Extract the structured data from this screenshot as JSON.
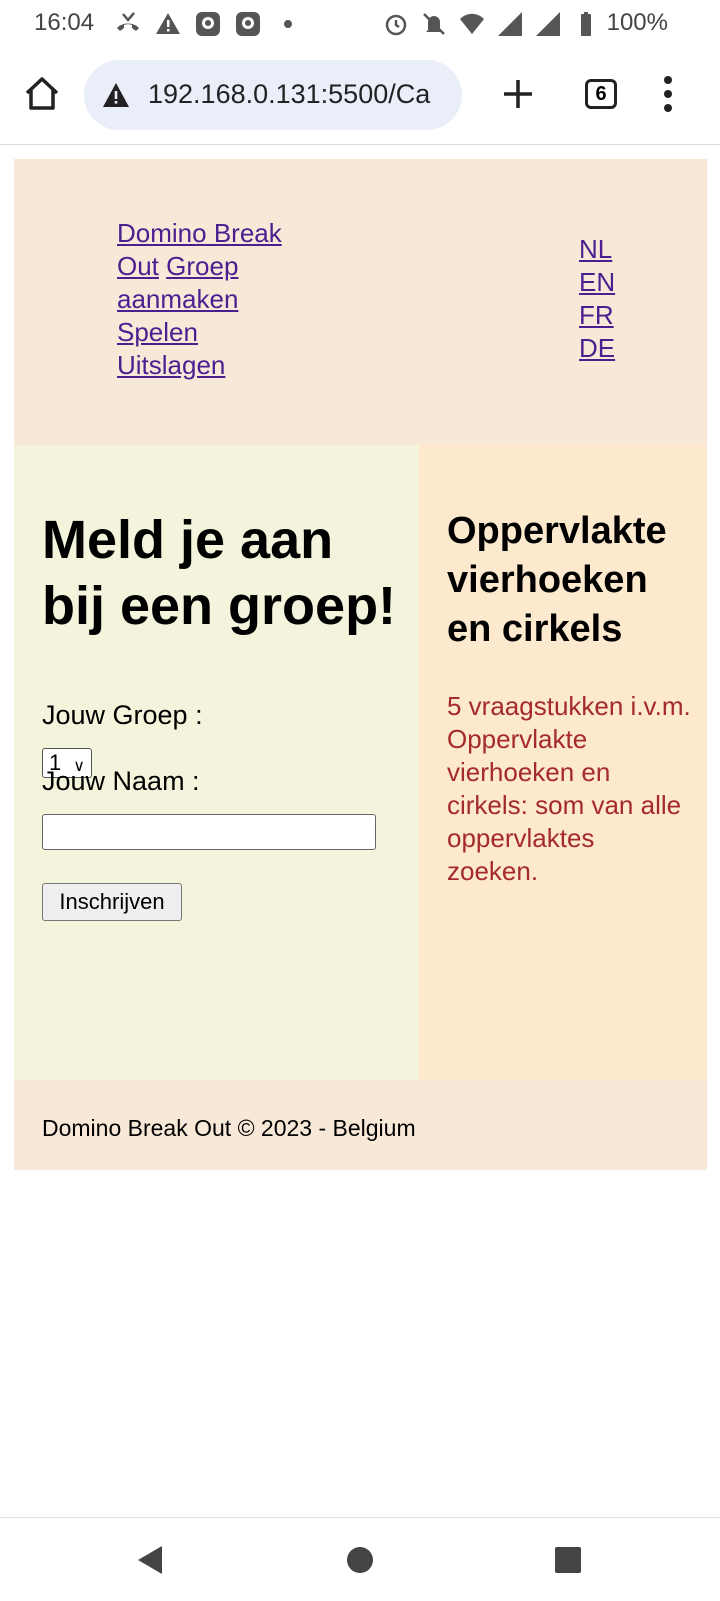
{
  "status_bar": {
    "time": "16:04",
    "battery": "100%",
    "icons_left": [
      "missed-call-icon",
      "warning-icon",
      "app-icon",
      "app-icon",
      "dot-icon"
    ],
    "icons_right": [
      "alarm-icon",
      "mute-icon",
      "wifi-icon",
      "signal-icon",
      "signal-icon",
      "battery-icon"
    ]
  },
  "browser": {
    "url": "192.168.0.131:5500/Ca",
    "tab_count": "6"
  },
  "header": {
    "nav": {
      "brand": "Domino Break Out",
      "create_group": "Groep aanmaken",
      "play": "Spelen",
      "results": "Uitslagen"
    },
    "languages": [
      "NL",
      "EN",
      "FR",
      "DE"
    ]
  },
  "main": {
    "heading": "Meld je aan bij een groep!",
    "group_label": "Jouw Groep :",
    "group_selected": "1",
    "name_label": "Jouw Naam :",
    "name_value": "",
    "submit_label": "Inschrijven"
  },
  "aside": {
    "title": "Oppervlakte vierhoeken en cirkels",
    "description": "5 vraagstukken i.v.m. Oppervlakte vierhoeken en cirkels: som van alle oppervlaktes zoeken."
  },
  "footer": {
    "text": "Domino Break Out © 2023 - Belgium"
  },
  "colors": {
    "header_bg": "#f8e8d8",
    "main_bg": "#f4f4dc",
    "aside_bg": "#fde9cd",
    "link": "#4b1f8f",
    "description": "#a52a2a"
  }
}
